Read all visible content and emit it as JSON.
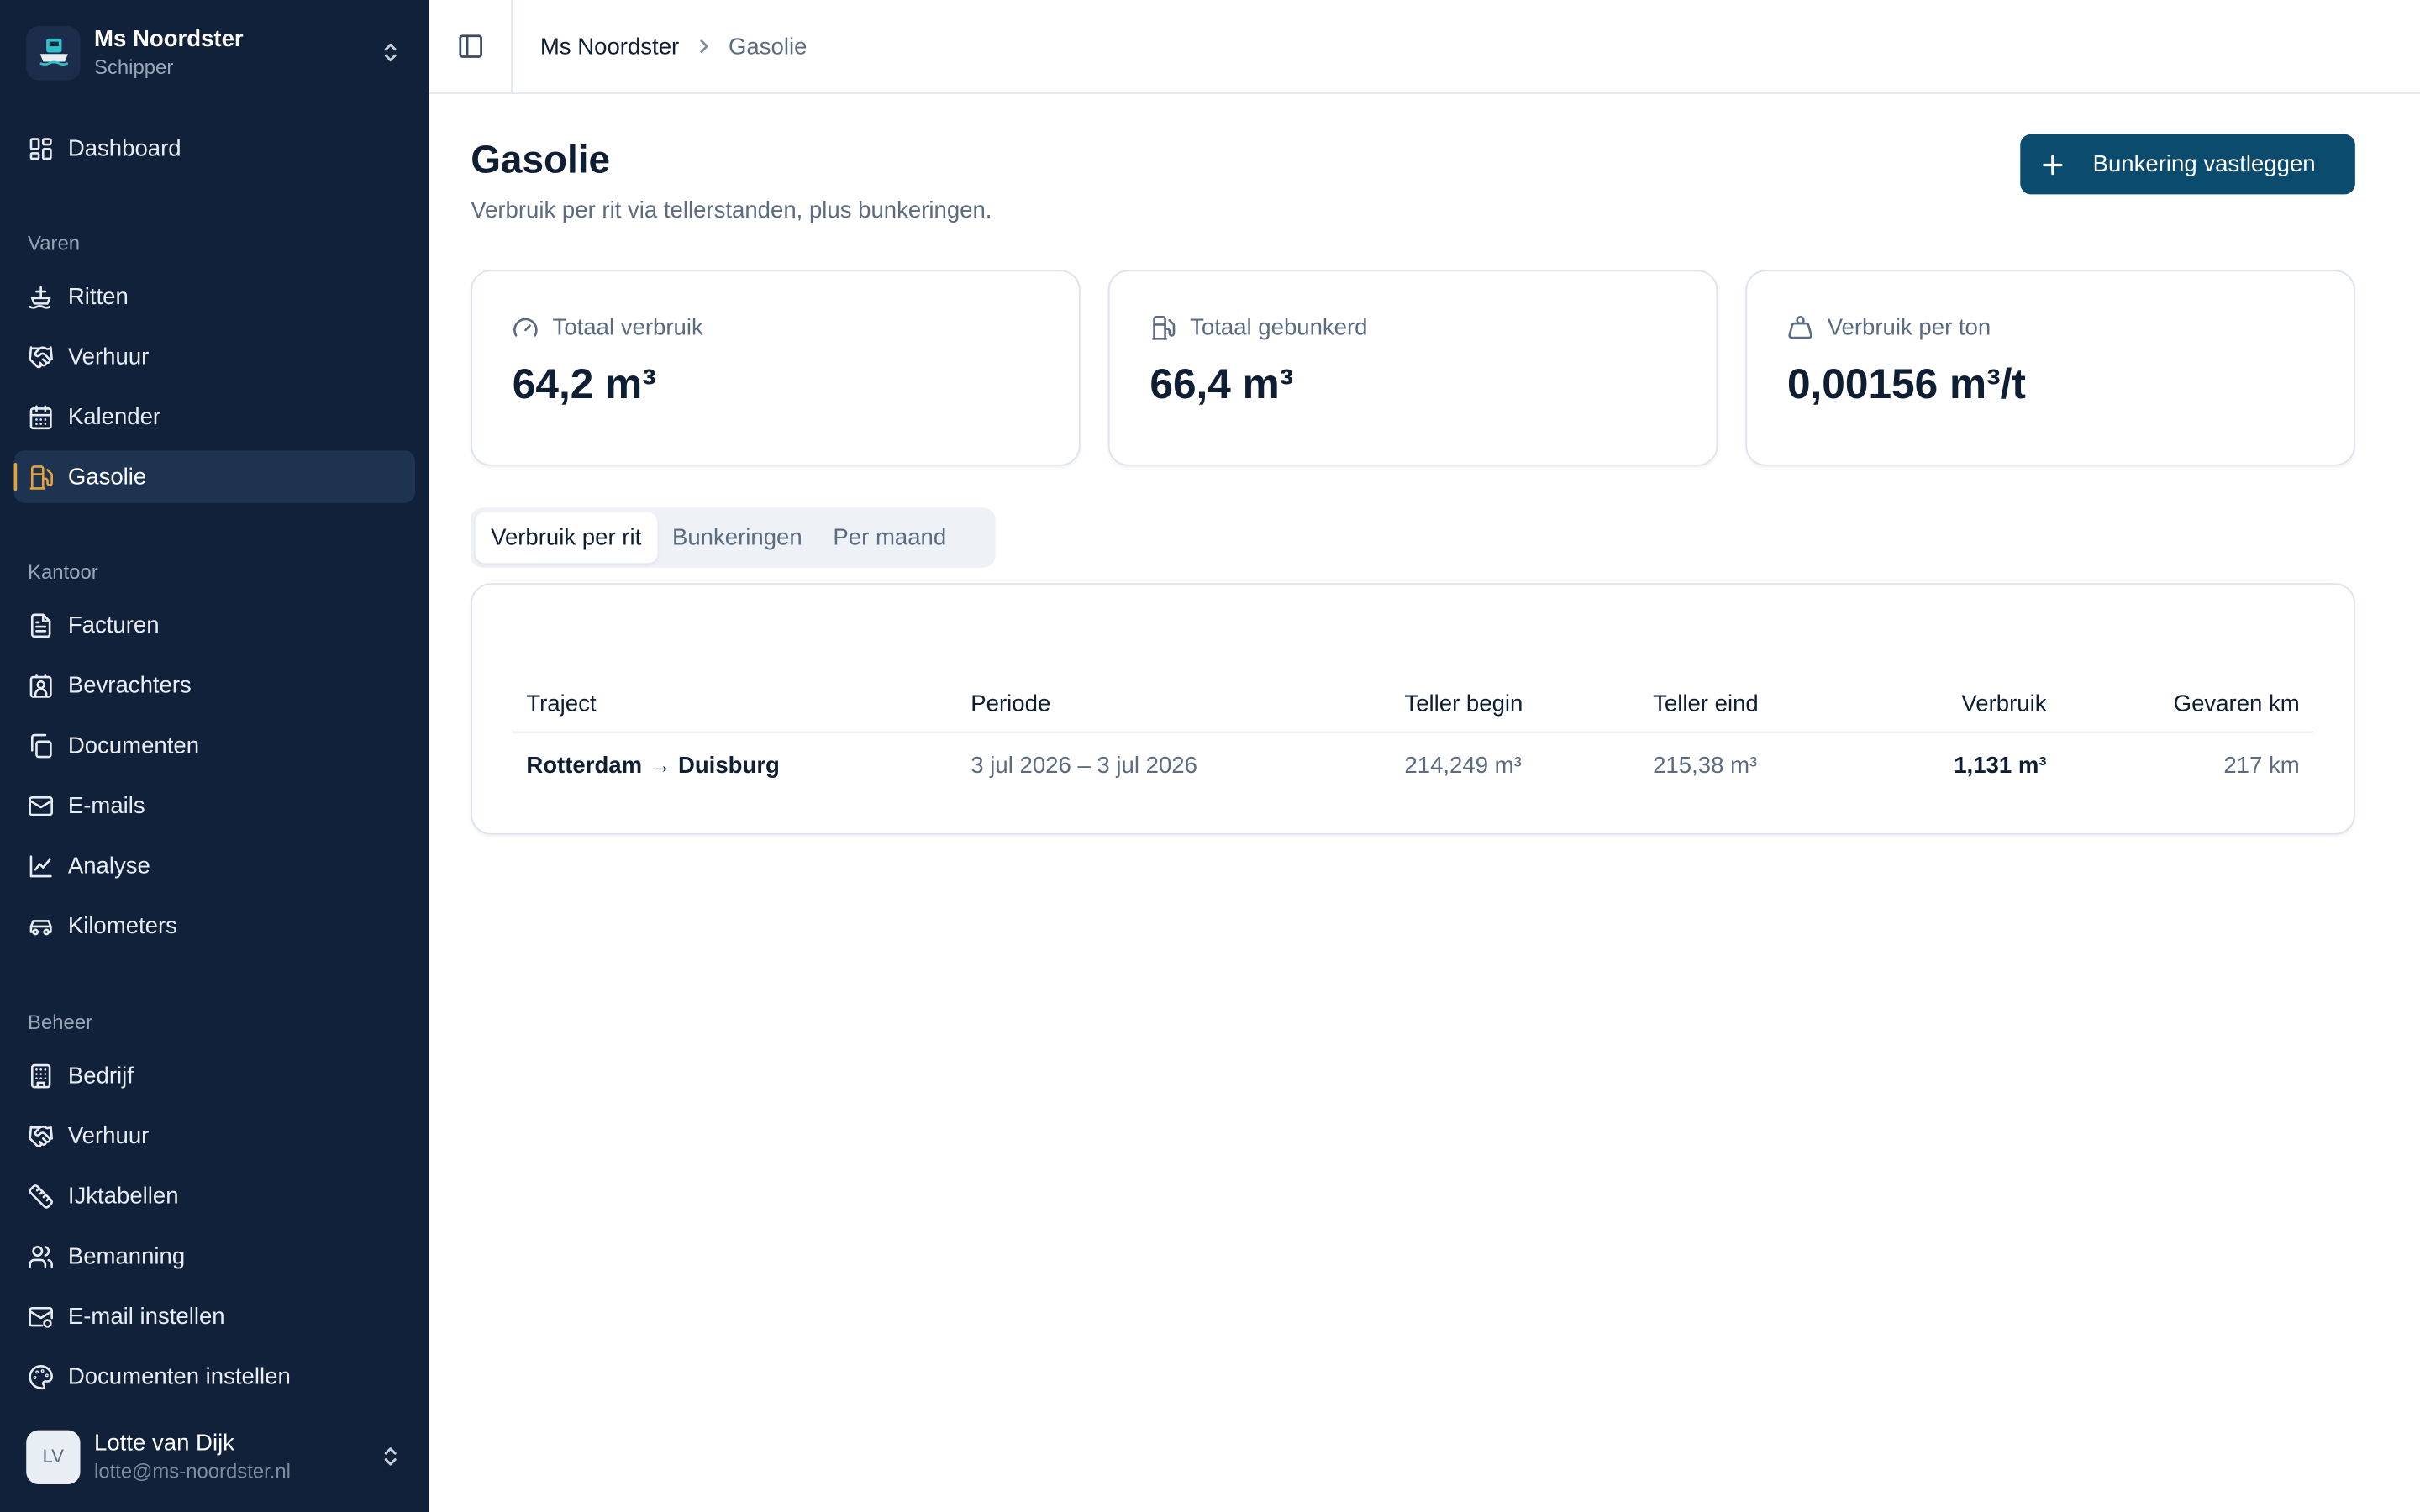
{
  "workspace": {
    "name": "Ms Noordster",
    "role": "Schipper"
  },
  "nav": {
    "dashboard": "Dashboard",
    "sections": [
      "Varen",
      "Kantoor",
      "Beheer"
    ],
    "varen": [
      {
        "label": "Ritten",
        "icon": "ship-icon"
      },
      {
        "label": "Verhuur",
        "icon": "handshake-icon"
      },
      {
        "label": "Kalender",
        "icon": "calendar-icon"
      },
      {
        "label": "Gasolie",
        "icon": "fuel-icon",
        "active": true
      }
    ],
    "kantoor": [
      {
        "label": "Facturen",
        "icon": "invoice-icon"
      },
      {
        "label": "Bevrachters",
        "icon": "contact-icon"
      },
      {
        "label": "Documenten",
        "icon": "documents-icon"
      },
      {
        "label": "E-mails",
        "icon": "mail-icon"
      },
      {
        "label": "Analyse",
        "icon": "chart-icon"
      },
      {
        "label": "Kilometers",
        "icon": "car-icon"
      }
    ],
    "beheer": [
      {
        "label": "Bedrijf",
        "icon": "building-icon"
      },
      {
        "label": "Verhuur",
        "icon": "handshake-icon"
      },
      {
        "label": "IJktabellen",
        "icon": "ruler-icon"
      },
      {
        "label": "Bemanning",
        "icon": "users-icon"
      },
      {
        "label": "E-mail instellen",
        "icon": "mail-settings-icon"
      },
      {
        "label": "Documenten instellen",
        "icon": "palette-icon"
      }
    ]
  },
  "user": {
    "initials": "LV",
    "name": "Lotte van Dijk",
    "email": "lotte@ms-noordster.nl"
  },
  "breadcrumb": {
    "parent": "Ms Noordster",
    "current": "Gasolie"
  },
  "page": {
    "title": "Gasolie",
    "subtitle": "Verbruik per rit via tellerstanden, plus bunkeringen.",
    "primary_button": "Bunkering vastleggen"
  },
  "stats": [
    {
      "label": "Totaal verbruik",
      "value": "64,2 m³",
      "icon": "gauge-icon"
    },
    {
      "label": "Totaal gebunkerd",
      "value": "66,4 m³",
      "icon": "fuel-icon"
    },
    {
      "label": "Verbruik per ton",
      "value": "0,00156 m³/t",
      "icon": "weight-icon"
    }
  ],
  "tabs": [
    "Verbruik per rit",
    "Bunkeringen",
    "Per maand"
  ],
  "table": {
    "columns": [
      "Traject",
      "Periode",
      "Teller begin",
      "Teller eind",
      "Verbruik",
      "Gevaren km"
    ],
    "rows": [
      {
        "traject": "Rotterdam → Duisburg",
        "periode": "3 jul 2026 – 3 jul 2026",
        "teller_begin": "214,249 m³",
        "teller_eind": "215,38 m³",
        "verbruik": "1,131 m³",
        "km": "217 km"
      }
    ]
  },
  "colors": {
    "sidebar_bg": "#11213a",
    "accent": "#e8a23a",
    "primary": "#0b4c6e"
  }
}
